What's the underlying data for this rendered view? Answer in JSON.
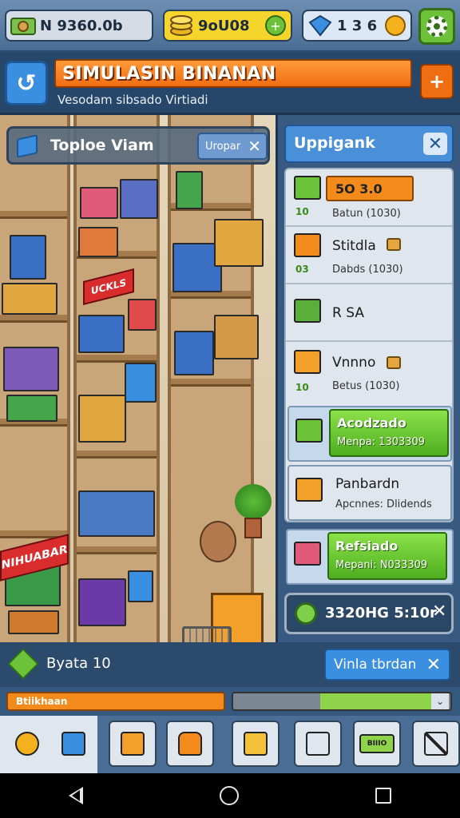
{
  "status_bar": {
    "money": "N 9360.0b",
    "coins": "9oU08",
    "gems": "1 3 6",
    "coins_plus_icon": "plus-icon",
    "settings_icon": "gear-icon"
  },
  "header": {
    "title": "SIMULASIN BINANAN",
    "subtitle": "Vesodam sibsado Virtiadi",
    "back_icon": "back-arrow-icon",
    "add_icon": "plus-icon"
  },
  "store": {
    "search_label": "Toploe Viam",
    "search_tag": "Uropar",
    "top_sign": "UCKLS",
    "wall_sign": "NIHUABAR"
  },
  "upgrade_panel": {
    "title": "Uppigank",
    "rows": [
      {
        "count": "10",
        "price": "5O 3.0",
        "sub": "Batun (1030)",
        "icon": "green-crate-icon"
      },
      {
        "count": "03",
        "name": "Stitdla",
        "sub": "Dabds (1030)",
        "icon": "orange-crate-icon"
      },
      {
        "name": "R SA",
        "icon": "cart-icon"
      },
      {
        "count": "10",
        "name": "Vnnno",
        "sub": "Betus (1030)",
        "icon": "box-icon"
      }
    ],
    "cards": [
      {
        "title": "Acodzado",
        "sub": "Menpa: 1303309",
        "style": "green"
      },
      {
        "title": "Panbardn",
        "sub": "Apcnnes: Dlidends",
        "style": "plain"
      },
      {
        "title": "Refsiado",
        "sub": "Mepani: N033309",
        "style": "green"
      }
    ],
    "timer": "3320HG 5:10r"
  },
  "bottom_info": {
    "stats": "Byata 10",
    "action_button": "Vinla tbrdan",
    "progress_label": "Btiikhaan",
    "progress_fill_fraction": 0.52
  },
  "toolbar": {
    "tools": [
      "key-icon",
      "tag-icon",
      "notepad-icon",
      "bag-icon",
      "box-open-icon",
      "clipboard-icon",
      "cash-icon",
      "crossed-box-icon"
    ],
    "cash_label": "BIIIO"
  },
  "colors": {
    "accent_orange": "#f06e12",
    "accent_blue": "#3b8fe0",
    "accent_green": "#6cc33a",
    "panel_dark": "#26466a"
  }
}
